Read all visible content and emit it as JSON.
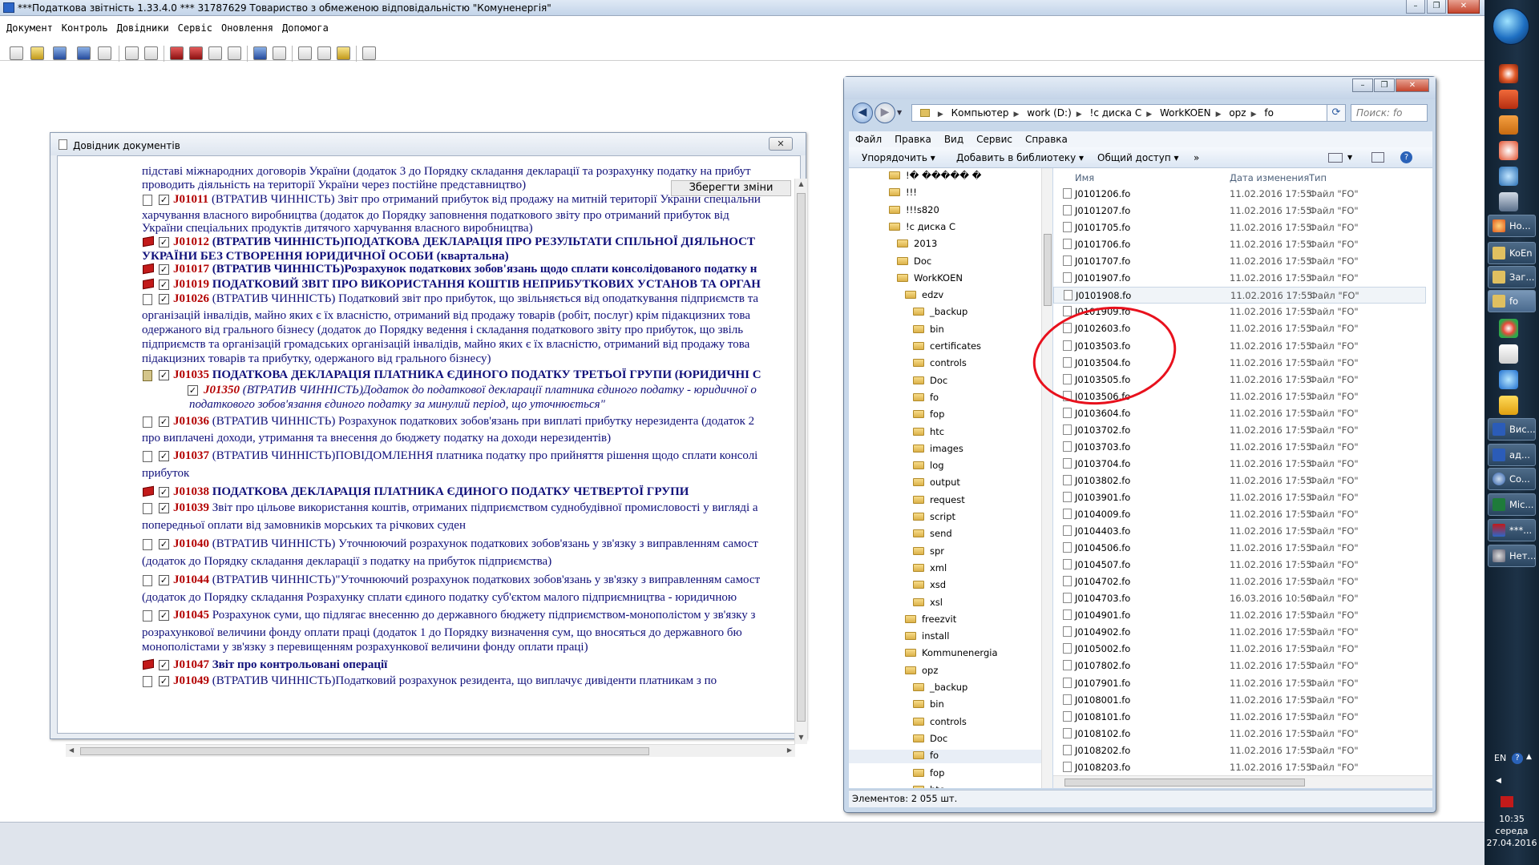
{
  "app": {
    "title": "***Податкова звітність 1.33.4.0 *** 31787629 Товариство з обмеженою відповідальністю \"Комуненергія\"",
    "menu": [
      "Документ",
      "Контроль",
      "Довідники",
      "Сервіс",
      "Оновлення",
      "Допомога"
    ],
    "window_buttons": {
      "minimize": "–",
      "restore": "❐",
      "close": "✕"
    }
  },
  "directory": {
    "title": "Довідник документів",
    "close_label": "✕",
    "save_label": "Зберегти зміни",
    "lines": [
      {
        "code": "",
        "text": "підставі міжнародних договорів України (додаток 3 до Порядку складання декларації та розрахунку податку на прибут"
      },
      {
        "code": "",
        "text": "проводить діяльність на території України через постійне представництво)"
      },
      {
        "code": "J01011",
        "text": " (ВТРАТИВ ЧИННІСТЬ) Звіт про отриманий прибуток від продажу на митній території України спеціальни"
      },
      {
        "code": "",
        "text": "харчування власного виробництва (додаток до Порядку заповнення податкового звіту про отриманий прибуток від"
      },
      {
        "code": "",
        "text": "України спеціальних продуктів дитячого харчування власного виробництва)"
      },
      {
        "code": "J01012",
        "text": " (ВТРАТИВ ЧИННІСТЬ)ПОДАТКОВА ДЕКЛАРАЦІЯ ПРО РЕЗУЛЬТАТИ СПІЛЬНОЇ ДІЯЛЬНОСТ"
      },
      {
        "code": "",
        "text": "УКРАЇНИ БЕЗ СТВОРЕННЯ ЮРИДИЧНОЇ ОСОБИ (квартальна)"
      },
      {
        "code": "J01017",
        "text": " (ВТРАТИВ ЧИННІСТЬ)Розрахунок податкових зобов'язань щодо сплати консолідованого податку н"
      },
      {
        "code": "J01019",
        "text": " ПОДАТКОВИЙ ЗВІТ ПРО ВИКОРИСТАННЯ КОШТІВ НЕПРИБУТКОВИХ УСТАНОВ ТА ОРГАН"
      },
      {
        "code": "J01026",
        "text": " (ВТРАТИВ ЧИННІСТЬ) Податковий звіт про прибуток, що звільняється від оподаткування підприємств та"
      },
      {
        "code": "",
        "text": "організацій інвалідів, майно яких є їх власністю, отриманий від продажу товарів (робіт, послуг) крім підакцизних това"
      },
      {
        "code": "",
        "text": "одержаного від грального бізнесу (додаток до Порядку ведення і складання податкового звіту про прибуток, що звіль"
      },
      {
        "code": "",
        "text": "підприємств та організацій громадських організацій інвалідів, майно яких є їх власністю, отриманий від продажу това"
      },
      {
        "code": "",
        "text": "підакцизних товарів та прибутку, одержаного від грального бізнесу)"
      },
      {
        "code": "J01035",
        "text": " ПОДАТКОВА ДЕКЛАРАЦІЯ ПЛАТНИКА ЄДИНОГО ПОДАТКУ ТРЕТЬОЇ ГРУПИ (ЮРИДИЧНІ С"
      },
      {
        "code": "J01350",
        "text": " (ВТРАТИВ ЧИННІСТЬ)Додаток до податкової декларації платника єдиного податку - юридичної о"
      },
      {
        "code": "",
        "text": "податкового зобов'язання єдиного податку за минулий період, що уточнюється\""
      },
      {
        "code": "J01036",
        "text": " (ВТРАТИВ ЧИННІСТЬ) Розрахунок податкових зобов'язань при виплаті прибутку нерезидента (додаток 2"
      },
      {
        "code": "",
        "text": "про виплачені доходи, утримання та внесення до бюджету податку на доходи нерезидентів)"
      },
      {
        "code": "J01037",
        "text": " (ВТРАТИВ ЧИННІСТЬ)ПОВІДОМЛЕННЯ платника податку про прийняття рішення щодо сплати консолі"
      },
      {
        "code": "",
        "text": "прибуток"
      },
      {
        "code": "J01038",
        "text": " ПОДАТКОВА ДЕКЛАРАЦІЯ ПЛАТНИКА ЄДИНОГО ПОДАТКУ ЧЕТВЕРТОЇ ГРУПИ"
      },
      {
        "code": "J01039",
        "text": " Звіт про цільове використання коштів, отриманих підприємством суднобудівної промисловості у вигляді а"
      },
      {
        "code": "",
        "text": "попередньої оплати від замовників морських та річкових суден"
      },
      {
        "code": "J01040",
        "text": " (ВТРАТИВ ЧИННІСТЬ) Уточнюючий розрахунок податкових зобов'язань у зв'язку з виправленням самост"
      },
      {
        "code": "",
        "text": "(додаток до Порядку складання декларації з податку на прибуток підприємства)"
      },
      {
        "code": "J01044",
        "text": " (ВТРАТИВ ЧИННІСТЬ)\"Уточнюючий розрахунок податкових зобов'язань у зв'язку з виправленням самост"
      },
      {
        "code": "",
        "text": "(додаток до Порядку складання Розрахунку сплати єдиного податку суб'єктом малого підприємництва - юридичною"
      },
      {
        "code": "J01045",
        "text": " Розрахунок суми, що підлягає внесенню до державного бюджету підприємством-монополістом у зв'язку з"
      },
      {
        "code": "",
        "text": "розрахункової величини фонду оплати праці (додаток 1 до Порядку визначення сум, що вносяться до державного бю"
      },
      {
        "code": "",
        "text": "монополістами у зв'язку з перевищенням розрахункової величини фонду оплати праці)"
      },
      {
        "code": "J01047",
        "text": " Звіт про контрольовані операції"
      },
      {
        "code": "J01049",
        "text": " (ВТРАТИВ ЧИННІСТЬ)Податковий розрахунок резидента, що виплачує дивіденти платникам з по"
      }
    ]
  },
  "explorer": {
    "breadcrumb": [
      "Компьютер",
      "work (D:)",
      "!c диска C",
      "WorkKOEN",
      "opz",
      "fo"
    ],
    "search_placeholder": "Поиск: fo",
    "menu": [
      "Файл",
      "Правка",
      "Вид",
      "Сервис",
      "Справка"
    ],
    "commands": {
      "organize": "Упорядочить ▾",
      "add_library": "Добавить в библиотеку ▾",
      "share": "Общий доступ ▾",
      "more": "»"
    },
    "columns": {
      "name": "Имя",
      "date": "Дата изменения",
      "type": "Тип"
    },
    "tree": [
      "!� ����� �",
      "!!!",
      "!!!s820",
      "!c диска C",
      "2013",
      "Doc",
      "WorkKOEN",
      "edzv",
      "_backup",
      "bin",
      "certificates",
      "controls",
      "Doc",
      "fo",
      "fop",
      "htc",
      "images",
      "log",
      "output",
      "request",
      "script",
      "send",
      "spr",
      "xml",
      "xsd",
      "xsl",
      "freezvit",
      "install",
      "Kommunenergia",
      "opz",
      "_backup",
      "bin",
      "controls",
      "Doc",
      "fo",
      "fop",
      "htc"
    ],
    "files": [
      {
        "name": "J0101206.fo",
        "date": "11.02.2016 17:55",
        "type": "Файл \"FO\""
      },
      {
        "name": "J0101207.fo",
        "date": "11.02.2016 17:55",
        "type": "Файл \"FO\""
      },
      {
        "name": "J0101705.fo",
        "date": "11.02.2016 17:55",
        "type": "Файл \"FO\""
      },
      {
        "name": "J0101706.fo",
        "date": "11.02.2016 17:55",
        "type": "Файл \"FO\""
      },
      {
        "name": "J0101707.fo",
        "date": "11.02.2016 17:55",
        "type": "Файл \"FO\""
      },
      {
        "name": "J0101907.fo",
        "date": "11.02.2016 17:55",
        "type": "Файл \"FO\""
      },
      {
        "name": "J0101908.fo",
        "date": "11.02.2016 17:55",
        "type": "Файл \"FO\""
      },
      {
        "name": "J0101909.fo",
        "date": "11.02.2016 17:55",
        "type": "Файл \"FO\""
      },
      {
        "name": "J0102603.fo",
        "date": "11.02.2016 17:55",
        "type": "Файл \"FO\""
      },
      {
        "name": "J0103503.fo",
        "date": "11.02.2016 17:55",
        "type": "Файл \"FO\""
      },
      {
        "name": "J0103504.fo",
        "date": "11.02.2016 17:55",
        "type": "Файл \"FO\""
      },
      {
        "name": "J0103505.fo",
        "date": "11.02.2016 17:55",
        "type": "Файл \"FO\""
      },
      {
        "name": "J0103506.fo",
        "date": "11.02.2016 17:55",
        "type": "Файл \"FO\""
      },
      {
        "name": "J0103604.fo",
        "date": "11.02.2016 17:55",
        "type": "Файл \"FO\""
      },
      {
        "name": "J0103702.fo",
        "date": "11.02.2016 17:55",
        "type": "Файл \"FO\""
      },
      {
        "name": "J0103703.fo",
        "date": "11.02.2016 17:55",
        "type": "Файл \"FO\""
      },
      {
        "name": "J0103704.fo",
        "date": "11.02.2016 17:55",
        "type": "Файл \"FO\""
      },
      {
        "name": "J0103802.fo",
        "date": "11.02.2016 17:55",
        "type": "Файл \"FO\""
      },
      {
        "name": "J0103901.fo",
        "date": "11.02.2016 17:55",
        "type": "Файл \"FO\""
      },
      {
        "name": "J0104009.fo",
        "date": "11.02.2016 17:55",
        "type": "Файл \"FO\""
      },
      {
        "name": "J0104403.fo",
        "date": "11.02.2016 17:55",
        "type": "Файл \"FO\""
      },
      {
        "name": "J0104506.fo",
        "date": "11.02.2016 17:55",
        "type": "Файл \"FO\""
      },
      {
        "name": "J0104507.fo",
        "date": "11.02.2016 17:55",
        "type": "Файл \"FO\""
      },
      {
        "name": "J0104702.fo",
        "date": "11.02.2016 17:55",
        "type": "Файл \"FO\""
      },
      {
        "name": "J0104703.fo",
        "date": "16.03.2016 10:56",
        "type": "Файл \"FO\""
      },
      {
        "name": "J0104901.fo",
        "date": "11.02.2016 17:55",
        "type": "Файл \"FO\""
      },
      {
        "name": "J0104902.fo",
        "date": "11.02.2016 17:55",
        "type": "Файл \"FO\""
      },
      {
        "name": "J0105002.fo",
        "date": "11.02.2016 17:55",
        "type": "Файл \"FO\""
      },
      {
        "name": "J0107802.fo",
        "date": "11.02.2016 17:55",
        "type": "Файл \"FO\""
      },
      {
        "name": "J0107901.fo",
        "date": "11.02.2016 17:55",
        "type": "Файл \"FO\""
      },
      {
        "name": "J0108001.fo",
        "date": "11.02.2016 17:55",
        "type": "Файл \"FO\""
      },
      {
        "name": "J0108101.fo",
        "date": "11.02.2016 17:55",
        "type": "Файл \"FO\""
      },
      {
        "name": "J0108102.fo",
        "date": "11.02.2016 17:55",
        "type": "Файл \"FO\""
      },
      {
        "name": "J0108202.fo",
        "date": "11.02.2016 17:55",
        "type": "Файл \"FO\""
      },
      {
        "name": "J0108203.fo",
        "date": "11.02.2016 17:55",
        "type": "Файл \"FO\""
      }
    ],
    "status": "Элементов: 2 055 шт."
  },
  "taskbar": {
    "tasks": [
      "Но...",
      "KoEn",
      "Заг...",
      "fo",
      "Вис...",
      "ад...",
      "Co...",
      "Mic...",
      "***...",
      "Нет..."
    ],
    "lang": "EN",
    "time": "10:35",
    "day": "середа",
    "date": "27.04.2016"
  }
}
